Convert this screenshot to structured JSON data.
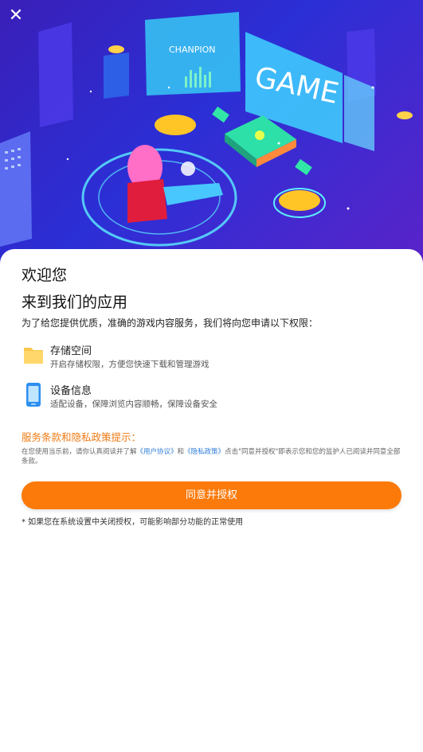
{
  "hero": {
    "screen_text_left": "CHANPION",
    "screen_text_right": "GAME"
  },
  "close_icon": "close-icon",
  "welcome": "欢迎您",
  "title": "来到我们的应用",
  "intro": "为了给您提供优质，准确的游戏内容服务，我们将向您申请以下权限：",
  "permissions": [
    {
      "icon": "folder-icon",
      "name": "存储空间",
      "desc": "开启存储权限，方便您快速下载和管理游戏"
    },
    {
      "icon": "phone-icon",
      "name": "设备信息",
      "desc": "适配设备，保障浏览内容顺畅，保障设备安全"
    }
  ],
  "policy": {
    "heading": "服务条款和隐私政策提示：",
    "text_part1": "在您使用当乐前，请你认真阅读并了解",
    "user_agreement": "《用户协议》",
    "and": "和",
    "privacy_policy": "《隐私政策》",
    "text_part2": "点击\"同意并授权\"即表示您和您的监护人已阅读并同意全部条款。"
  },
  "agree_button": "同意并授权",
  "note": "* 如果您在系统设置中关闭授权，可能影响部分功能的正常使用",
  "colors": {
    "accent": "#fb7a0a",
    "link": "#2e7cd6",
    "hero": "#2b2fd6"
  }
}
